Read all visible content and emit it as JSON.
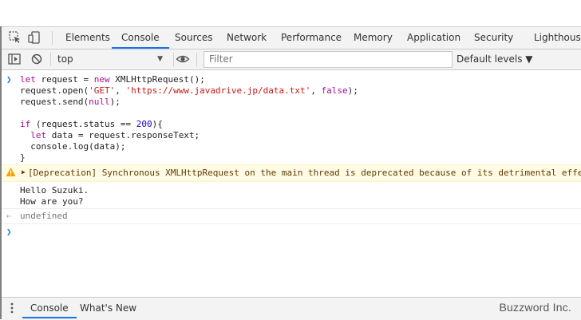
{
  "tabs": [
    {
      "label": "Elements"
    },
    {
      "label": "Console",
      "active": true
    },
    {
      "label": "Sources"
    },
    {
      "label": "Network"
    },
    {
      "label": "Performance"
    },
    {
      "label": "Memory"
    },
    {
      "label": "Application"
    },
    {
      "label": "Security"
    },
    {
      "label": "Lighthouse"
    }
  ],
  "toolbar": {
    "context": "top",
    "filter_placeholder": "Filter",
    "levels": "Default levels ▼"
  },
  "console": {
    "input_lines": [
      "let request = new XMLHttpRequest();",
      "request.open('GET', 'https://www.javadrive.jp/data.txt', false);",
      "request.send(null);",
      "",
      "if (request.status == 200){",
      "  let data = request.responseText;",
      "  console.log(data);",
      "}"
    ],
    "warning": "[Deprecation] Synchronous XMLHttpRequest on the main thread is deprecated because of its detrimental effe",
    "log_lines": [
      "Hello Suzuki.",
      "How are you?"
    ],
    "result": "undefined"
  },
  "drawer": {
    "tabs": [
      {
        "label": "Console",
        "active": true
      },
      {
        "label": "What's New"
      }
    ],
    "watermark": "Buzzword Inc."
  },
  "colors": {
    "accent": "#1a73e8",
    "warning_bg": "#fffbe5",
    "keyword": "#aa0d91",
    "string": "#c41a16",
    "number": "#1c00cf"
  },
  "icons": [
    "inspect-element-icon",
    "device-toolbar-icon",
    "sidebar-toggle-icon",
    "clear-console-icon",
    "eye-icon",
    "warning-icon",
    "expand-triangle-icon",
    "prompt-chevron-icon",
    "return-arrow-icon",
    "drawer-menu-icon"
  ]
}
